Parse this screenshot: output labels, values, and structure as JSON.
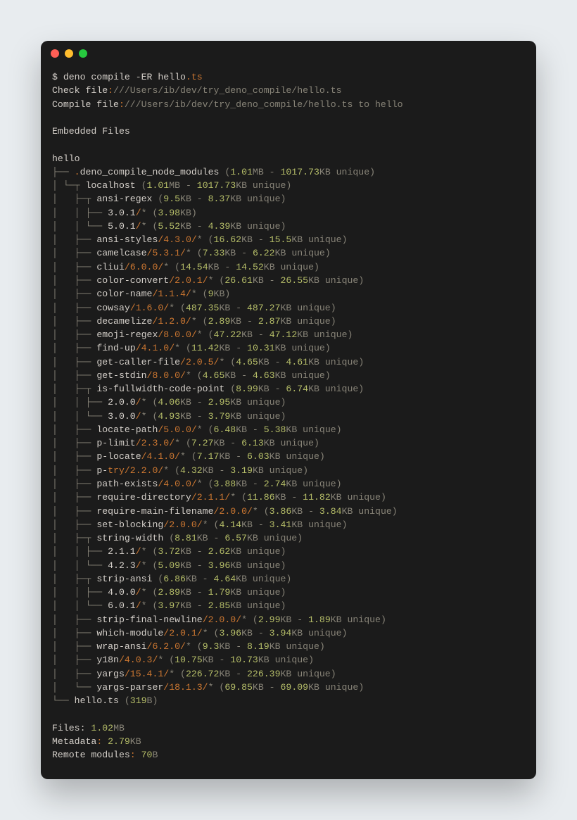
{
  "command": {
    "prompt": "$ ",
    "text": "deno compile -ER hello",
    "dot": ".",
    "ext": "ts"
  },
  "check": {
    "label": "Check file",
    "colon": ":",
    "path": "///Users/ib/dev/try_deno_compile/hello.ts"
  },
  "compile": {
    "label": "Compile file",
    "colon": ":",
    "path": "///Users/ib/dev/try_deno_compile/hello.ts to hello"
  },
  "header": "Embedded Files",
  "root": "hello",
  "lines": [
    {
      "id": "l0",
      "bars": "├── ",
      "extra": ".",
      "name": "deno_compile_node_modules",
      "ver": "",
      "glob": "",
      "open": " (",
      "n1": "1.01",
      "u1": "MB - ",
      "n2": "1017.73",
      "u2": "KB unique",
      "close": ")"
    },
    {
      "id": "l1",
      "bars": "│ └─┬ ",
      "name": "localhost",
      "ver": "",
      "glob": "",
      "open": " (",
      "n1": "1.01",
      "u1": "MB - ",
      "n2": "1017.73",
      "u2": "KB unique",
      "close": ")"
    },
    {
      "id": "l2",
      "bars": "│   ├─┬ ",
      "name": "ansi-regex",
      "ver": "",
      "glob": "",
      "open": " (",
      "n1": "9.5",
      "u1": "KB - ",
      "n2": "8.37",
      "u2": "KB unique",
      "close": ")"
    },
    {
      "id": "l3",
      "bars": "│   │ ├── ",
      "name": "3.0.1",
      "ver": "/",
      "glob": "* (",
      "n1": "3.98",
      "u1": "KB",
      "close": ")"
    },
    {
      "id": "l4",
      "bars": "│   │ └── ",
      "name": "5.0.1",
      "ver": "/",
      "glob": "* (",
      "n1": "5.52",
      "u1": "KB - ",
      "n2": "4.39",
      "u2": "KB unique",
      "close": ")"
    },
    {
      "id": "l5",
      "bars": "│   ├── ",
      "name": "ansi-styles",
      "ver": "/4.3.0/",
      "glob": "* (",
      "n1": "16.62",
      "u1": "KB - ",
      "n2": "15.5",
      "u2": "KB unique",
      "close": ")"
    },
    {
      "id": "l6",
      "bars": "│   ├── ",
      "name": "camelcase",
      "ver": "/5.3.1/",
      "glob": "* (",
      "n1": "7.33",
      "u1": "KB - ",
      "n2": "6.22",
      "u2": "KB unique",
      "close": ")"
    },
    {
      "id": "l7",
      "bars": "│   ├── ",
      "name": "cliui",
      "ver": "/6.0.0/",
      "glob": "* (",
      "n1": "14.54",
      "u1": "KB - ",
      "n2": "14.52",
      "u2": "KB unique",
      "close": ")"
    },
    {
      "id": "l8",
      "bars": "│   ├── ",
      "name": "color-convert",
      "ver": "/2.0.1/",
      "glob": "* (",
      "n1": "26.61",
      "u1": "KB - ",
      "n2": "26.55",
      "u2": "KB unique",
      "close": ")"
    },
    {
      "id": "l9",
      "bars": "│   ├── ",
      "name": "color-name",
      "ver": "/1.1.4/",
      "glob": "* (",
      "n1": "9",
      "u1": "KB",
      "close": ")"
    },
    {
      "id": "l10",
      "bars": "│   ├── ",
      "name": "cowsay",
      "ver": "/1.6.0/",
      "glob": "* (",
      "n1": "487.35",
      "u1": "KB - ",
      "n2": "487.27",
      "u2": "KB unique",
      "close": ")"
    },
    {
      "id": "l11",
      "bars": "│   ├── ",
      "name": "decamelize",
      "ver": "/1.2.0/",
      "glob": "* (",
      "n1": "2.89",
      "u1": "KB - ",
      "n2": "2.87",
      "u2": "KB unique",
      "close": ")"
    },
    {
      "id": "l12",
      "bars": "│   ├── ",
      "name": "emoji-regex",
      "ver": "/8.0.0/",
      "glob": "* (",
      "n1": "47.22",
      "u1": "KB - ",
      "n2": "47.12",
      "u2": "KB unique",
      "close": ")"
    },
    {
      "id": "l13",
      "bars": "│   ├── ",
      "name": "find-up",
      "ver": "/4.1.0/",
      "glob": "* (",
      "n1": "11.42",
      "u1": "KB - ",
      "n2": "10.31",
      "u2": "KB unique",
      "close": ")"
    },
    {
      "id": "l14",
      "bars": "│   ├── ",
      "name": "get-caller-file",
      "ver": "/2.0.5/",
      "glob": "* (",
      "n1": "4.65",
      "u1": "KB - ",
      "n2": "4.61",
      "u2": "KB unique",
      "close": ")"
    },
    {
      "id": "l15",
      "bars": "│   ├── ",
      "name": "get-stdin",
      "ver": "/8.0.0/",
      "glob": "* (",
      "n1": "4.65",
      "u1": "KB - ",
      "n2": "4.63",
      "u2": "KB unique",
      "close": ")"
    },
    {
      "id": "l16",
      "bars": "│   ├─┬ ",
      "name": "is-fullwidth-code-point",
      "ver": "",
      "glob": "",
      "open": " (",
      "n1": "8.99",
      "u1": "KB - ",
      "n2": "6.74",
      "u2": "KB unique",
      "close": ")"
    },
    {
      "id": "l17",
      "bars": "│   │ ├── ",
      "name": "2.0.0",
      "ver": "/",
      "glob": "* (",
      "n1": "4.06",
      "u1": "KB - ",
      "n2": "2.95",
      "u2": "KB unique",
      "close": ")"
    },
    {
      "id": "l18",
      "bars": "│   │ └── ",
      "name": "3.0.0",
      "ver": "/",
      "glob": "* (",
      "n1": "4.93",
      "u1": "KB - ",
      "n2": "3.79",
      "u2": "KB unique",
      "close": ")"
    },
    {
      "id": "l19",
      "bars": "│   ├── ",
      "name": "locate-path",
      "ver": "/5.0.0/",
      "glob": "* (",
      "n1": "6.48",
      "u1": "KB - ",
      "n2": "5.38",
      "u2": "KB unique",
      "close": ")"
    },
    {
      "id": "l20",
      "bars": "│   ├── ",
      "name": "p-limit",
      "ver": "/2.3.0/",
      "glob": "* (",
      "n1": "7.27",
      "u1": "KB - ",
      "n2": "6.13",
      "u2": "KB unique",
      "close": ")"
    },
    {
      "id": "l21",
      "bars": "│   ├── ",
      "name": "p-locate",
      "ver": "/4.1.0/",
      "glob": "* (",
      "n1": "7.17",
      "u1": "KB - ",
      "n2": "6.03",
      "u2": "KB unique",
      "close": ")"
    },
    {
      "id": "l22",
      "bars": "│   ├── ",
      "name": "p-",
      "kw": "try",
      "ver": "/2.2.0/",
      "glob": "* (",
      "n1": "4.32",
      "u1": "KB - ",
      "n2": "3.19",
      "u2": "KB unique",
      "close": ")"
    },
    {
      "id": "l23",
      "bars": "│   ├── ",
      "name": "path-exists",
      "ver": "/4.0.0/",
      "glob": "* (",
      "n1": "3.88",
      "u1": "KB - ",
      "n2": "2.74",
      "u2": "KB unique",
      "close": ")"
    },
    {
      "id": "l24",
      "bars": "│   ├── ",
      "name": "require-directory",
      "ver": "/2.1.1/",
      "glob": "* (",
      "n1": "11.86",
      "u1": "KB - ",
      "n2": "11.82",
      "u2": "KB unique",
      "close": ")"
    },
    {
      "id": "l25",
      "bars": "│   ├── ",
      "name": "require-main-filename",
      "ver": "/2.0.0/",
      "glob": "* (",
      "n1": "3.86",
      "u1": "KB - ",
      "n2": "3.84",
      "u2": "KB unique",
      "close": ")"
    },
    {
      "id": "l26",
      "bars": "│   ├── ",
      "name": "set-blocking",
      "ver": "/2.0.0/",
      "glob": "* (",
      "n1": "4.14",
      "u1": "KB - ",
      "n2": "3.41",
      "u2": "KB unique",
      "close": ")"
    },
    {
      "id": "l27",
      "bars": "│   ├─┬ ",
      "name": "string-width",
      "ver": "",
      "glob": "",
      "open": " (",
      "n1": "8.81",
      "u1": "KB - ",
      "n2": "6.57",
      "u2": "KB unique",
      "close": ")"
    },
    {
      "id": "l28",
      "bars": "│   │ ├── ",
      "name": "2.1.1",
      "ver": "/",
      "glob": "* (",
      "n1": "3.72",
      "u1": "KB - ",
      "n2": "2.62",
      "u2": "KB unique",
      "close": ")"
    },
    {
      "id": "l29",
      "bars": "│   │ └── ",
      "name": "4.2.3",
      "ver": "/",
      "glob": "* (",
      "n1": "5.09",
      "u1": "KB - ",
      "n2": "3.96",
      "u2": "KB unique",
      "close": ")"
    },
    {
      "id": "l30",
      "bars": "│   ├─┬ ",
      "name": "strip-ansi",
      "ver": "",
      "glob": "",
      "open": " (",
      "n1": "6.86",
      "u1": "KB - ",
      "n2": "4.64",
      "u2": "KB unique",
      "close": ")"
    },
    {
      "id": "l31",
      "bars": "│   │ ├── ",
      "name": "4.0.0",
      "ver": "/",
      "glob": "* (",
      "n1": "2.89",
      "u1": "KB - ",
      "n2": "1.79",
      "u2": "KB unique",
      "close": ")"
    },
    {
      "id": "l32",
      "bars": "│   │ └── ",
      "name": "6.0.1",
      "ver": "/",
      "glob": "* (",
      "n1": "3.97",
      "u1": "KB - ",
      "n2": "2.85",
      "u2": "KB unique",
      "close": ")"
    },
    {
      "id": "l33",
      "bars": "│   ├── ",
      "name": "strip-final-newline",
      "ver": "/2.0.0/",
      "glob": "* (",
      "n1": "2.99",
      "u1": "KB - ",
      "n2": "1.89",
      "u2": "KB unique",
      "close": ")"
    },
    {
      "id": "l34",
      "bars": "│   ├── ",
      "name": "which-module",
      "ver": "/2.0.1/",
      "glob": "* (",
      "n1": "3.96",
      "u1": "KB - ",
      "n2": "3.94",
      "u2": "KB unique",
      "close": ")"
    },
    {
      "id": "l35",
      "bars": "│   ├── ",
      "name": "wrap-ansi",
      "ver": "/6.2.0/",
      "glob": "* (",
      "n1": "9.3",
      "u1": "KB - ",
      "n2": "8.19",
      "u2": "KB unique",
      "close": ")"
    },
    {
      "id": "l36",
      "bars": "│   ├── ",
      "name": "y18n",
      "ver": "/4.0.3/",
      "glob": "* (",
      "n1": "10.75",
      "u1": "KB - ",
      "n2": "10.73",
      "u2": "KB unique",
      "close": ")"
    },
    {
      "id": "l37",
      "bars": "│   ├── ",
      "name": "yargs",
      "ver": "/15.4.1/",
      "glob": "* (",
      "n1": "226.72",
      "u1": "KB - ",
      "n2": "226.39",
      "u2": "KB unique",
      "close": ")"
    },
    {
      "id": "l38",
      "bars": "│   └── ",
      "name": "yargs-parser",
      "ver": "/18.1.3/",
      "glob": "* (",
      "n1": "69.85",
      "u1": "KB - ",
      "n2": "69.09",
      "u2": "KB unique",
      "close": ")"
    },
    {
      "id": "l39",
      "bars": "└── ",
      "name": "hello.ts",
      "ver": "",
      "glob": "",
      "open": " (",
      "n1": "319",
      "u1": "B",
      "close": ")"
    }
  ],
  "footer": {
    "files_label": "Files: ",
    "files_n": "1.02",
    "files_u": "MB",
    "meta_label": "Metadata",
    "meta_colon": ": ",
    "meta_n": "2.79",
    "meta_u": "KB",
    "remote_label": "Remote modules",
    "remote_colon": ": ",
    "remote_n": "70",
    "remote_u": "B"
  }
}
